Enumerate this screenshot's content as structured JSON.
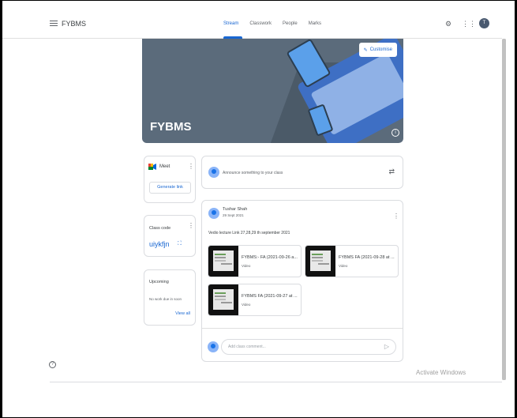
{
  "header": {
    "app_title": "FYBMS",
    "tabs": [
      {
        "label": "Stream",
        "active": true
      },
      {
        "label": "Classwork",
        "active": false
      },
      {
        "label": "People",
        "active": false
      },
      {
        "label": "Marks",
        "active": false
      }
    ],
    "avatar_initial": "T",
    "icons": [
      "menu-icon",
      "settings-icon",
      "apps-grid-icon"
    ]
  },
  "banner": {
    "class_name": "FYBMS",
    "customise_label": "Customise"
  },
  "meet": {
    "label": "Meet",
    "generate_link_label": "Generate link"
  },
  "class_code": {
    "label": "Class code",
    "value": "uiykfjn"
  },
  "upcoming": {
    "label": "Upcoming",
    "empty_text": "No work due in soon",
    "view_all_label": "View all"
  },
  "announce": {
    "placeholder": "Announce something to your class"
  },
  "post": {
    "author": "Tushar Shah",
    "date": "29 Sept 2021",
    "body": "Vedio lecture Link 27,28,29 th september 2021",
    "attachments": [
      {
        "title": "FYBMS:- FA (2021-09-26 a...",
        "type": "Video"
      },
      {
        "title": "FYBMS FA (2021-09-28 at ...",
        "type": "Video"
      },
      {
        "title": "FYBMS FA (2021-09-27 at ...",
        "type": "Video"
      }
    ],
    "comment_placeholder": "Add class comment..."
  },
  "overlay": {
    "activate_windows": "Activate Windows"
  },
  "colors": {
    "accent": "#1967d2",
    "banner": "#5b6b7b"
  }
}
